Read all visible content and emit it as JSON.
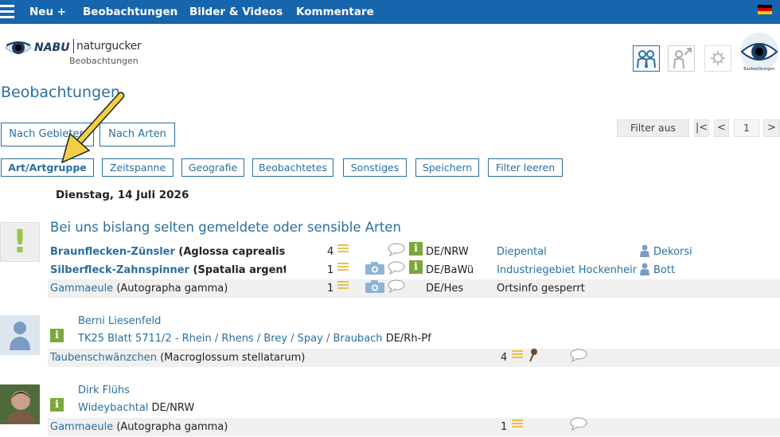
{
  "nav": {
    "new": "Neu +",
    "observations": "Beobachtungen",
    "media": "Bilder & Videos",
    "comments": "Kommentare"
  },
  "brand": {
    "nabu": "NABU",
    "name": "naturgucker",
    "sub": "Beobachtungen",
    "badge": "Beobachtungen"
  },
  "page": {
    "title": "Beobachtungen"
  },
  "views": {
    "areas": "Nach Gebieten",
    "species": "Nach Arten"
  },
  "filter": {
    "toggle": "Filter aus",
    "first": "|<",
    "prev": "<",
    "page": "1",
    "next": ">"
  },
  "filters": [
    "Art/Artgruppe",
    "Zeitspanne",
    "Geografie",
    "Beobachtetes",
    "Sonstiges",
    "Speichern",
    "Filter leeren"
  ],
  "date": "Dienstag, 14 Juli 2026",
  "rare": {
    "heading": "Bei uns bislang selten gemeldete oder sensible Arten",
    "alert": "!",
    "rows": [
      {
        "name": "Braunflecken-Zünsler",
        "sci": "(Aglossa caprealis",
        "count": "4",
        "region": "DE/NRW",
        "place": "Diepental",
        "observer": "Dekorsi"
      },
      {
        "name": "Silberfleck-Zahnspinner",
        "sci": "(Spatalia argent",
        "count": "1",
        "region": "DE/BaWü",
        "place": "Industriegebiet Hockenheim",
        "observer": "Bott"
      },
      {
        "name": "Gammaeule",
        "sci": "(Autographa gamma)",
        "count": "1",
        "region": "DE/Hes",
        "place": "Ortsinfo gesperrt"
      }
    ]
  },
  "entries": [
    {
      "observer": "Berni Liesenfeld",
      "location": "TK25 Blatt 5711/2 - Rhein / Rhens / Brey / Spay / Braubach",
      "region": "DE/Rh-Pf",
      "species": "Taubenschwänzchen",
      "sci": "(Macroglossum stellatarum)",
      "count": "4"
    },
    {
      "observer": "Dirk Flühs",
      "location": "Wideybachtal",
      "region": "DE/NRW",
      "species": "Gammaeule",
      "sci": "(Autographa gamma)",
      "count": "1"
    }
  ],
  "info_badge": "i",
  "colors": {
    "topbar": "#1765ad",
    "link": "#2a6fa0",
    "accent_yellow": "#f3cf45",
    "info_green": "#7aa83b"
  },
  "icons": {
    "menu": "hamburger-icon",
    "flag": "flag-germany-icon",
    "community": "people-icon",
    "profile": "person-arrow-icon",
    "settings": "gear-icon",
    "logo": "eye-logo-icon",
    "info": "info-icon",
    "photo": "camera-icon",
    "comment": "speech-bubble-icon",
    "details": "lines-icon",
    "observer": "person-icon",
    "pin": "pin-icon"
  }
}
